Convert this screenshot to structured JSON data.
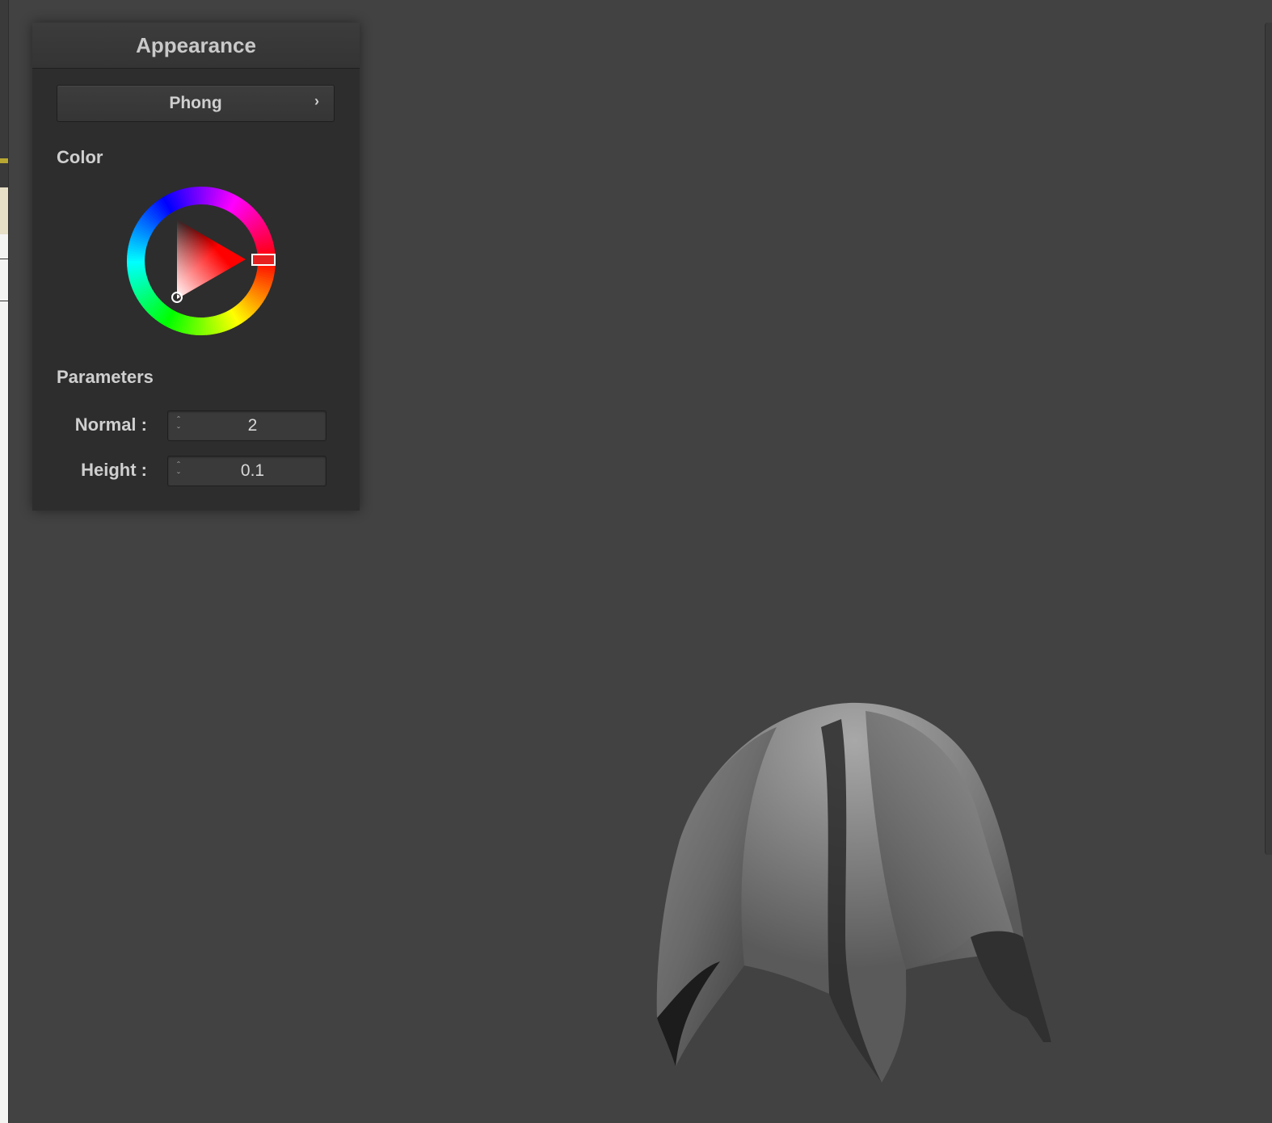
{
  "panel": {
    "title": "Appearance",
    "shader_button_label": "Phong",
    "color_section_label": "Color",
    "parameters_section_label": "Parameters",
    "selected_color": "#ff0000",
    "parameters": [
      {
        "label": "Normal :",
        "value": "2"
      },
      {
        "label": "Height :",
        "value": "0.1"
      }
    ]
  },
  "icons": {
    "shader_chevron": "chevron-right-icon",
    "spin_up": "spin-up-icon",
    "spin_down": "spin-down-icon"
  },
  "viewport": {
    "object": "draped-cloth-mesh",
    "background_color": "#424242"
  }
}
